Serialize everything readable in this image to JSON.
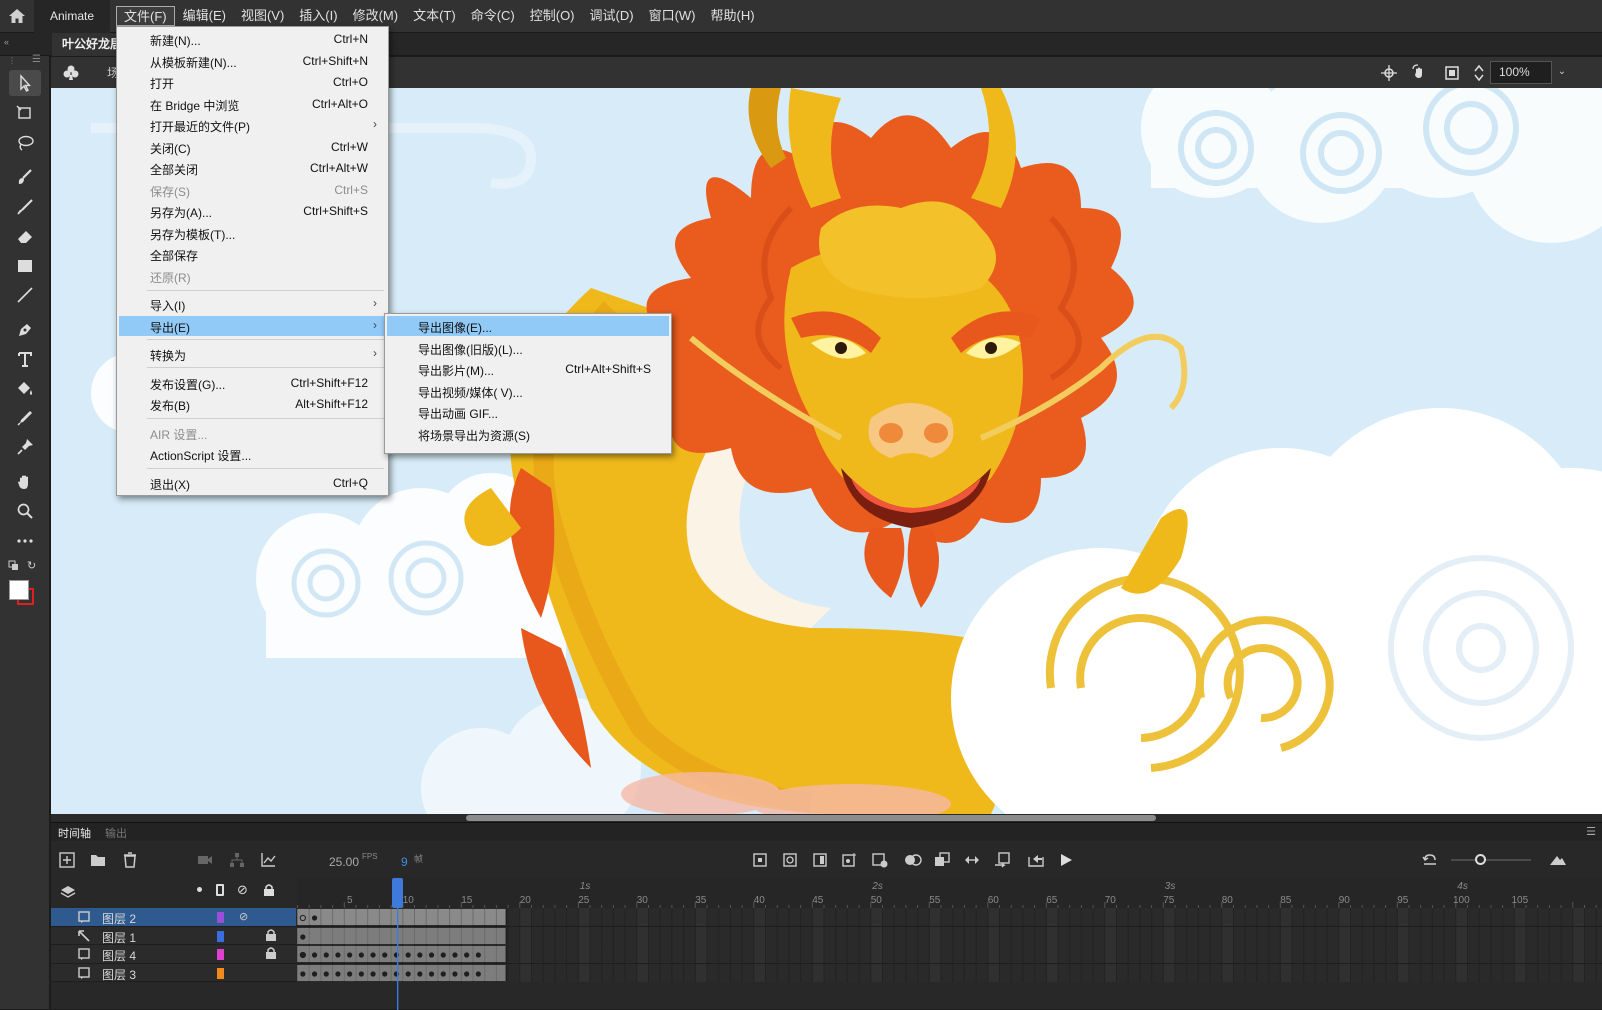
{
  "app": {
    "name": "Animate",
    "document_title": "叶公好龙居"
  },
  "menubar": [
    "文件(F)",
    "编辑(E)",
    "视图(V)",
    "插入(I)",
    "修改(M)",
    "文本(T)",
    "命令(C)",
    "控制(O)",
    "调试(D)",
    "窗口(W)",
    "帮助(H)"
  ],
  "editbar": {
    "scene_label": "场",
    "zoom": "100%"
  },
  "file_menu": {
    "new": {
      "label": "新建(N)...",
      "shortcut": "Ctrl+N"
    },
    "new_from_template": {
      "label": "从模板新建(N)...",
      "shortcut": "Ctrl+Shift+N"
    },
    "open": {
      "label": "打开",
      "shortcut": "Ctrl+O"
    },
    "browse_bridge": {
      "label": "在 Bridge 中浏览",
      "shortcut": "Ctrl+Alt+O"
    },
    "open_recent": {
      "label": "打开最近的文件(P)"
    },
    "close": {
      "label": "关闭(C)",
      "shortcut": "Ctrl+W"
    },
    "close_all": {
      "label": "全部关闭",
      "shortcut": "Ctrl+Alt+W"
    },
    "save": {
      "label": "保存(S)",
      "shortcut": "Ctrl+S"
    },
    "save_as": {
      "label": "另存为(A)...",
      "shortcut": "Ctrl+Shift+S"
    },
    "save_as_template": {
      "label": "另存为模板(T)..."
    },
    "save_all": {
      "label": "全部保存"
    },
    "revert": {
      "label": "还原(R)"
    },
    "import": {
      "label": "导入(I)"
    },
    "export": {
      "label": "导出(E)"
    },
    "convert_to": {
      "label": "转换为"
    },
    "publish_settings": {
      "label": "发布设置(G)...",
      "shortcut": "Ctrl+Shift+F12"
    },
    "publish": {
      "label": "发布(B)",
      "shortcut": "Alt+Shift+F12"
    },
    "air_settings": {
      "label": "AIR 设置..."
    },
    "actionscript_settings": {
      "label": "ActionScript 设置..."
    },
    "exit": {
      "label": "退出(X)",
      "shortcut": "Ctrl+Q"
    }
  },
  "export_menu": {
    "export_image": {
      "label": "导出图像(E)..."
    },
    "export_image_legacy": {
      "label": "导出图像(旧版)(L)..."
    },
    "export_movie": {
      "label": "导出影片(M)...",
      "shortcut": "Ctrl+Alt+Shift+S"
    },
    "export_video": {
      "label": "导出视频/媒体( V)..."
    },
    "export_gif": {
      "label": "导出动画 GIF..."
    },
    "export_scene_asset": {
      "label": "将场景导出为资源(S)"
    }
  },
  "timeline": {
    "tabs": [
      "时间轴",
      "输出"
    ],
    "fps": "25.00",
    "fps_label": "FPS",
    "current_frame": "9",
    "frame_label": "帧",
    "seconds": [
      "1s",
      "2s",
      "3s",
      "4s"
    ],
    "frame_numbers": [
      "5",
      "10",
      "15",
      "20",
      "25",
      "30",
      "35",
      "40",
      "45",
      "50",
      "55",
      "60",
      "65",
      "70",
      "75",
      "80",
      "85",
      "90",
      "95",
      "100",
      "105"
    ],
    "layers": [
      {
        "name": "图层 2",
        "color": "#9b4fd9",
        "selected": true,
        "hidden": true,
        "locked": false
      },
      {
        "name": "图层 1",
        "color": "#3a6de0",
        "selected": false,
        "hidden": false,
        "locked": true
      },
      {
        "name": "图层 4",
        "color": "#e040d0",
        "selected": false,
        "hidden": false,
        "locked": true
      },
      {
        "name": "图层 3",
        "color": "#f08a1a",
        "selected": false,
        "hidden": false,
        "locked": false
      }
    ]
  },
  "colors": {
    "accent": "#3d8ee6",
    "menu_highlight": "#91c9f7",
    "stage_sky": "#d7ecf8"
  }
}
